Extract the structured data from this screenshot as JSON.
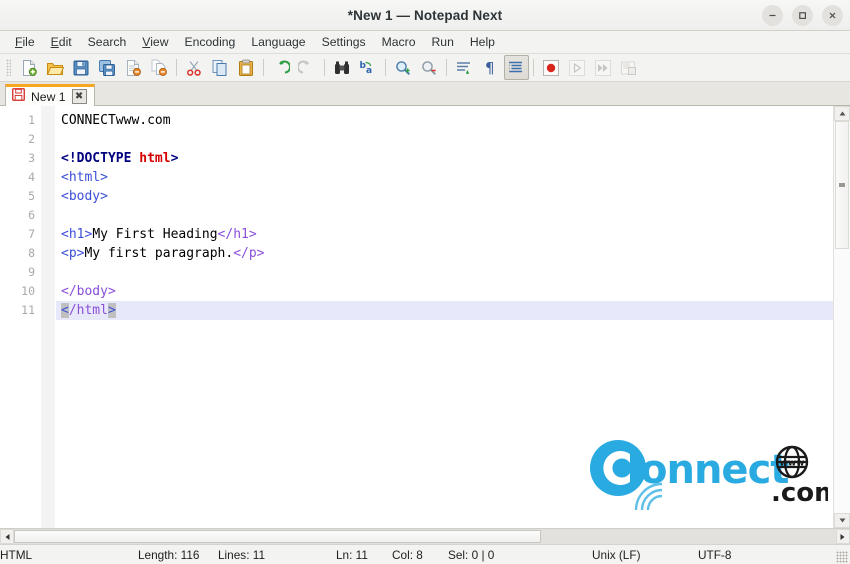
{
  "window": {
    "title": "*New 1 — Notepad Next",
    "controls": [
      {
        "name": "minimize-button",
        "glyph": "minimize-icon"
      },
      {
        "name": "maximize-button",
        "glyph": "maximize-icon"
      },
      {
        "name": "close-button",
        "glyph": "close-icon"
      }
    ]
  },
  "menubar": {
    "items": [
      {
        "label": "File",
        "mnemonic": "F"
      },
      {
        "label": "Edit",
        "mnemonic": "E"
      },
      {
        "label": "Search",
        "mnemonic": ""
      },
      {
        "label": "View",
        "mnemonic": "V"
      },
      {
        "label": "Encoding",
        "mnemonic": ""
      },
      {
        "label": "Language",
        "mnemonic": ""
      },
      {
        "label": "Settings",
        "mnemonic": ""
      },
      {
        "label": "Macro",
        "mnemonic": ""
      },
      {
        "label": "Run",
        "mnemonic": ""
      },
      {
        "label": "Help",
        "mnemonic": ""
      }
    ]
  },
  "toolbar": {
    "buttons": [
      {
        "name": "new-file-icon",
        "tooltip": "New"
      },
      {
        "name": "open-folder-icon",
        "tooltip": "Open"
      },
      {
        "name": "save-icon",
        "tooltip": "Save"
      },
      {
        "name": "save-all-icon",
        "tooltip": "Save All"
      },
      {
        "name": "close-file-icon",
        "tooltip": "Close"
      },
      {
        "name": "close-all-files-icon",
        "tooltip": "Close All"
      },
      {
        "name": "cut-scissors-icon",
        "tooltip": "Cut"
      },
      {
        "name": "copy-icon",
        "tooltip": "Copy"
      },
      {
        "name": "paste-clipboard-icon",
        "tooltip": "Paste"
      },
      {
        "name": "undo-arrow-icon",
        "tooltip": "Undo"
      },
      {
        "name": "redo-arrow-icon",
        "tooltip": "Redo"
      },
      {
        "name": "find-binoculars-icon",
        "tooltip": "Find"
      },
      {
        "name": "replace-icon",
        "tooltip": "Replace"
      },
      {
        "name": "zoom-in-icon",
        "tooltip": "Zoom In"
      },
      {
        "name": "zoom-out-icon",
        "tooltip": "Zoom Out"
      },
      {
        "name": "word-wrap-icon",
        "tooltip": "Word Wrap"
      },
      {
        "name": "show-pilcrow-icon",
        "tooltip": "Show All Characters"
      },
      {
        "name": "indent-guide-icon",
        "tooltip": "Indent Guide"
      },
      {
        "name": "record-macro-icon",
        "tooltip": "Start Recording"
      },
      {
        "name": "play-macro-icon",
        "tooltip": "Playback"
      },
      {
        "name": "fast-playback-icon",
        "tooltip": "Run Multiple Times"
      },
      {
        "name": "save-macro-icon",
        "tooltip": "Save Current Macro"
      }
    ]
  },
  "tabs": [
    {
      "label": "New 1",
      "modified": true,
      "close_glyph": "✖"
    }
  ],
  "editor": {
    "line_numbers": [
      "1",
      "2",
      "3",
      "4",
      "5",
      "6",
      "7",
      "8",
      "9",
      "10",
      "11"
    ],
    "current_line": 11,
    "lines": [
      {
        "n": 1,
        "tokens": [
          {
            "t": "CONNECTwww.com",
            "c": "plain"
          }
        ]
      },
      {
        "n": 2,
        "tokens": []
      },
      {
        "n": 3,
        "tokens": [
          {
            "t": "<!DOCTYPE ",
            "c": "doct"
          },
          {
            "t": "html",
            "c": "doctv"
          },
          {
            "t": ">",
            "c": "doct"
          }
        ]
      },
      {
        "n": 4,
        "tokens": [
          {
            "t": "<html>",
            "c": "tag"
          }
        ]
      },
      {
        "n": 5,
        "tokens": [
          {
            "t": "<body>",
            "c": "tag"
          }
        ]
      },
      {
        "n": 6,
        "tokens": []
      },
      {
        "n": 7,
        "tokens": [
          {
            "t": "<h1>",
            "c": "tag"
          },
          {
            "t": "My First Heading",
            "c": "plain"
          },
          {
            "t": "</h1>",
            "c": "tagp"
          }
        ]
      },
      {
        "n": 8,
        "tokens": [
          {
            "t": "<p>",
            "c": "tag"
          },
          {
            "t": "My first paragraph.",
            "c": "plain"
          },
          {
            "t": "</p>",
            "c": "tagp"
          }
        ]
      },
      {
        "n": 9,
        "tokens": []
      },
      {
        "n": 10,
        "tokens": [
          {
            "t": "</body>",
            "c": "tagp"
          }
        ]
      },
      {
        "n": 11,
        "tokens": [
          {
            "t": "<",
            "c": "brace"
          },
          {
            "t": "/html",
            "c": "tagp"
          },
          {
            "t": ">",
            "c": "brace"
          }
        ]
      }
    ]
  },
  "watermark": {
    "word": "onnect",
    "letter": "C",
    "globe_text": "www",
    "domain": ".com",
    "color": "#29abe2",
    "dark": "#1a1a1a"
  },
  "statusbar": {
    "language": "HTML",
    "length": "Length: 116",
    "lines": "Lines: 11",
    "ln": "Ln: 11",
    "col": "Col: 8",
    "sel": "Sel: 0 | 0",
    "eol": "Unix (LF)",
    "encoding": "UTF-8"
  },
  "colors": {
    "accent_tab": "#f5a623",
    "logo_blue": "#29abe2",
    "tag_blue": "#3b4fd8",
    "doctype_navy": "#00007f",
    "doctype_red": "#d40000",
    "current_line": "#e8e8fb"
  }
}
